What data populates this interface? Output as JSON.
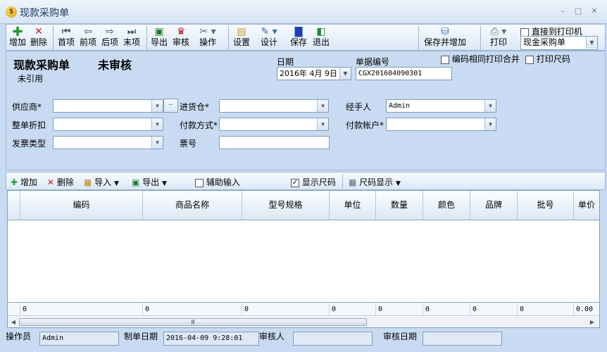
{
  "window": {
    "title": "现款采购单",
    "app_icon": "$",
    "minimize": "–",
    "maximize": "□",
    "close": "✕"
  },
  "toolbar": {
    "add": "增加",
    "delete": "删除",
    "first": "首项",
    "prev": "前项",
    "next": "后项",
    "last": "末项",
    "export": "导出",
    "audit": "审核",
    "operate": "操作",
    "settings": "设置",
    "design": "设计",
    "save": "保存",
    "exit": "退出",
    "save_and_add": "保存并增加",
    "print": "打印",
    "direct_print": "直接到打印机",
    "print_template": "现金采购单"
  },
  "form": {
    "doc_title": "现款采购单",
    "status": "未审核",
    "ref_status": "未引用",
    "date_label": "日期",
    "date_value": "2016年 4月 9日",
    "docno_label": "单据编号",
    "docno_value": "CGX201604090301",
    "merge_barcode": "编码相同打印合并",
    "print_size": "打印尺码",
    "supplier_label": "供应商*",
    "supplier_value": "",
    "warehouse_label": "进货仓*",
    "warehouse_value": "",
    "handler_label": "经手人",
    "handler_value": "Admin",
    "discount_label": "整单折扣",
    "discount_value": "",
    "paymethod_label": "付款方式*",
    "paymethod_value": "",
    "payaccount_label": "付款帐户*",
    "payaccount_value": "",
    "invoice_label": "发票类型",
    "invoice_value": "",
    "ticket_label": "票号",
    "ticket_value": ""
  },
  "gridtoolbar": {
    "add": "增加",
    "delete": "删除",
    "import": "导入",
    "export": "导出",
    "assist_input": "辅助输入",
    "show_size": "显示尺码",
    "size_display": "尺码显示"
  },
  "grid": {
    "columns": [
      "编码",
      "商品名称",
      "型号规格",
      "单位",
      "数量",
      "颜色",
      "品牌",
      "批号",
      "单价"
    ],
    "totals": [
      "0",
      "0",
      "0",
      "0",
      "0",
      "0",
      "0",
      "0",
      "0.00"
    ],
    "scroll_grip": "Ⅲ"
  },
  "statusbar": {
    "operator_label": "操作员",
    "operator_value": "Admin",
    "created_label": "制单日期",
    "created_value": "2016-04-09 9:28:01",
    "auditor_label": "审核人",
    "auditor_value": "",
    "audit_date_label": "审核日期",
    "audit_date_value": ""
  }
}
